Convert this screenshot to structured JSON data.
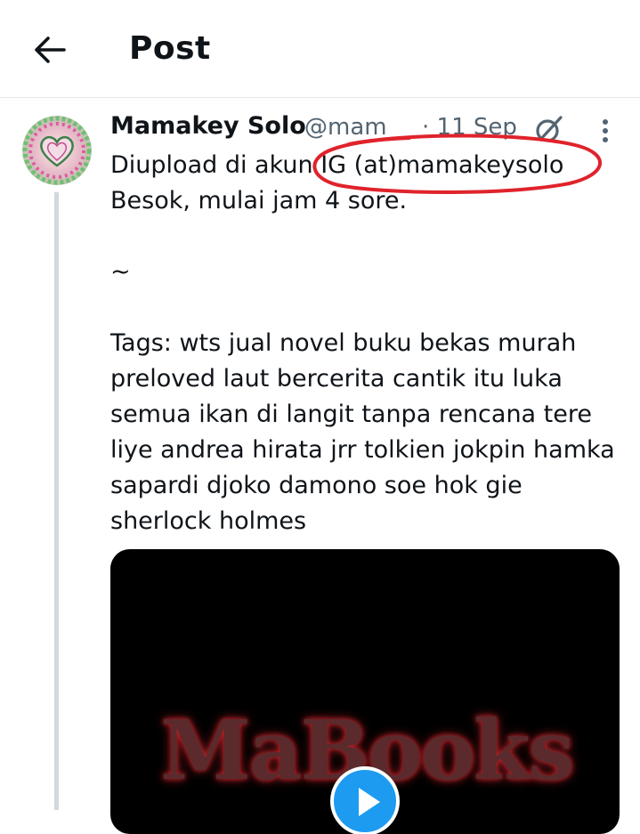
{
  "header": {
    "title": "Post",
    "back_icon": "arrow-left-icon"
  },
  "tweet": {
    "display_name": "Mamakey Solo",
    "handle": "@mam",
    "separator": "·",
    "date": "11 Sep",
    "text": "Diupload di akun IG (at)mamakeysolo\nBesok, mulai jam 4 sore.\n\n~\n\nTags: wts jual novel buku bekas murah preloved laut bercerita cantik itu luka semua ikan di langit tanpa rencana tere liye andrea hirata jrr tolkien jokpin hamka sapardi djoko damono soe hok gie sherlock holmes",
    "grok_icon": "grok-icon",
    "more_icon": "more-vertical-icon",
    "annotation_color": "#e0232b"
  },
  "media": {
    "watermark": "MaBooks",
    "play_icon": "play-icon"
  },
  "colors": {
    "accent": "#1d9bf0",
    "secondary_text": "#536471",
    "thread_line": "#cfd9de"
  }
}
